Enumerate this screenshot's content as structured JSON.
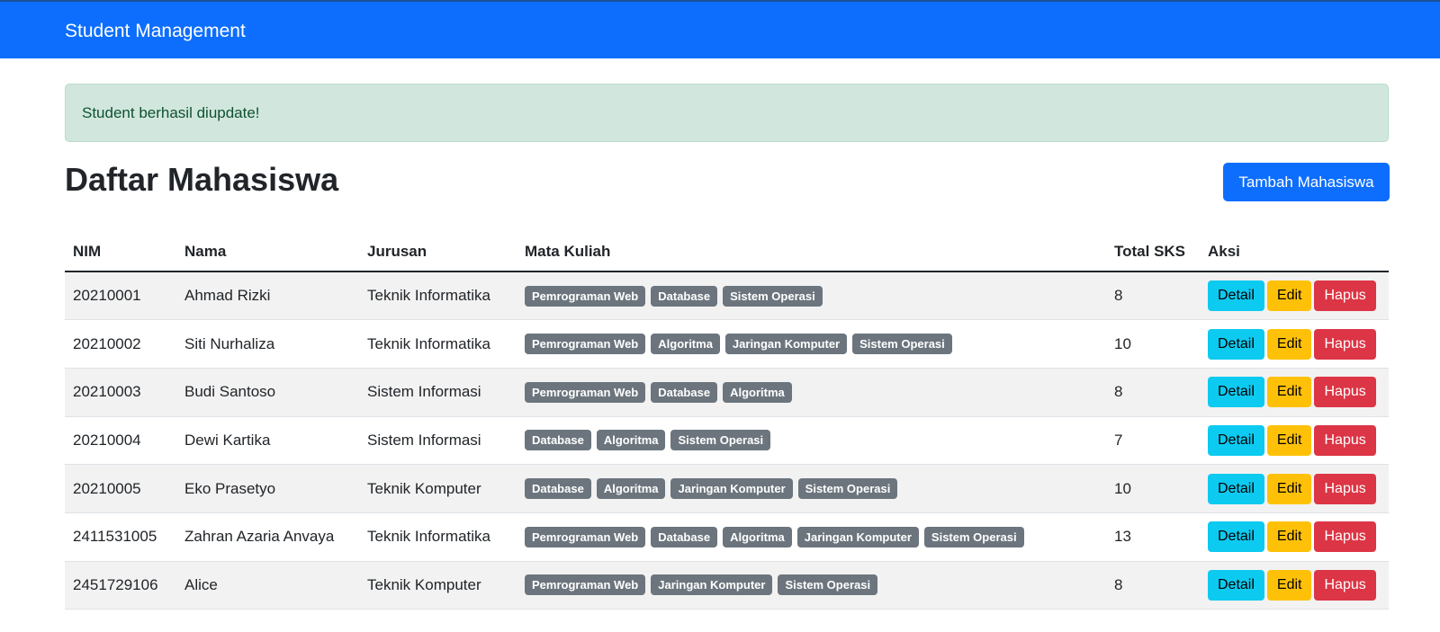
{
  "navbar": {
    "brand": "Student Management"
  },
  "alert": {
    "message": "Student berhasil diupdate!"
  },
  "page": {
    "title": "Daftar Mahasiswa",
    "add_button": "Tambah Mahasiswa"
  },
  "table": {
    "headers": [
      "NIM",
      "Nama",
      "Jurusan",
      "Mata Kuliah",
      "Total SKS",
      "Aksi"
    ],
    "actions": {
      "detail": "Detail",
      "edit": "Edit",
      "hapus": "Hapus"
    },
    "rows": [
      {
        "nim": "20210001",
        "nama": "Ahmad Rizki",
        "jurusan": "Teknik Informatika",
        "mata_kuliah": [
          "Pemrograman Web",
          "Database",
          "Sistem Operasi"
        ],
        "sks": "8"
      },
      {
        "nim": "20210002",
        "nama": "Siti Nurhaliza",
        "jurusan": "Teknik Informatika",
        "mata_kuliah": [
          "Pemrograman Web",
          "Algoritma",
          "Jaringan Komputer",
          "Sistem Operasi"
        ],
        "sks": "10"
      },
      {
        "nim": "20210003",
        "nama": "Budi Santoso",
        "jurusan": "Sistem Informasi",
        "mata_kuliah": [
          "Pemrograman Web",
          "Database",
          "Algoritma"
        ],
        "sks": "8"
      },
      {
        "nim": "20210004",
        "nama": "Dewi Kartika",
        "jurusan": "Sistem Informasi",
        "mata_kuliah": [
          "Database",
          "Algoritma",
          "Sistem Operasi"
        ],
        "sks": "7"
      },
      {
        "nim": "20210005",
        "nama": "Eko Prasetyo",
        "jurusan": "Teknik Komputer",
        "mata_kuliah": [
          "Database",
          "Algoritma",
          "Jaringan Komputer",
          "Sistem Operasi"
        ],
        "sks": "10"
      },
      {
        "nim": "2411531005",
        "nama": "Zahran Azaria Anvaya",
        "jurusan": "Teknik Informatika",
        "mata_kuliah": [
          "Pemrograman Web",
          "Database",
          "Algoritma",
          "Jaringan Komputer",
          "Sistem Operasi"
        ],
        "sks": "13"
      },
      {
        "nim": "2451729106",
        "nama": "Alice",
        "jurusan": "Teknik Komputer",
        "mata_kuliah": [
          "Pemrograman Web",
          "Jaringan Komputer",
          "Sistem Operasi"
        ],
        "sks": "8"
      }
    ]
  },
  "colors": {
    "primary": "#0d6efd",
    "success_bg": "#d1e7dd",
    "success_text": "#0f5132",
    "info": "#0dcaf0",
    "warning": "#ffc107",
    "danger": "#dc3545",
    "secondary": "#6c757d"
  }
}
